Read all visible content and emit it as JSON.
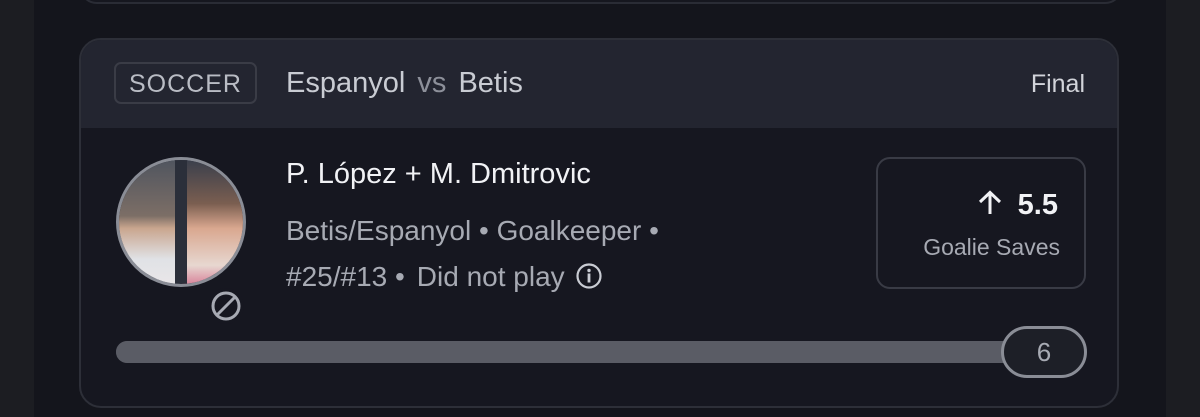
{
  "card": {
    "sport": "SOCCER",
    "matchup": {
      "home": "Espanyol",
      "vs": "vs",
      "away": "Betis"
    },
    "status": "Final"
  },
  "player": {
    "name": "P. López + M. Dmitrovic",
    "info_line1": "Betis/Espanyol • Goalkeeper •",
    "info_line2": "#25/#13 •",
    "availability": "Did not play"
  },
  "prop": {
    "direction": "over",
    "line": "5.5",
    "stat": "Goalie Saves"
  },
  "progress": {
    "result": "6",
    "fraction": 1.0
  },
  "icons": {
    "direction": "arrow-up-icon",
    "availability": "no-entry-icon",
    "info": "info-icon"
  },
  "colors": {
    "background": "#14151c",
    "card": "#161720",
    "header": "#232530",
    "text_primary": "#f1f2f5",
    "text_secondary": "#a7aab3"
  }
}
